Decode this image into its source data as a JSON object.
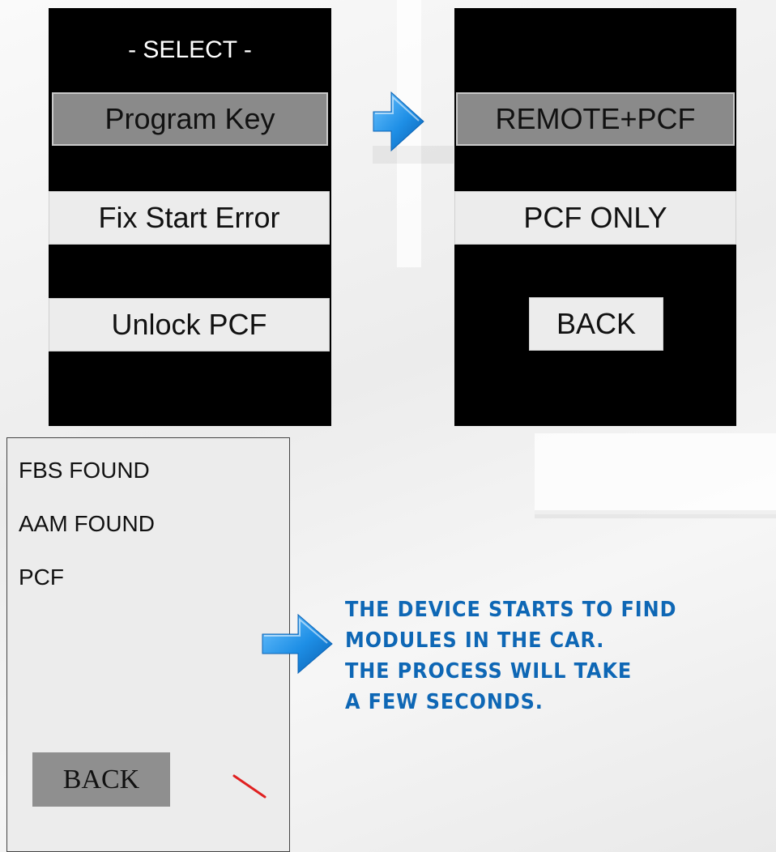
{
  "left_screen": {
    "title": "- SELECT -",
    "items": [
      {
        "label": "Program Key",
        "state": "selected"
      },
      {
        "label": "Fix Start Error",
        "state": "normal"
      },
      {
        "label": "Unlock PCF",
        "state": "normal"
      }
    ]
  },
  "right_screen": {
    "items": [
      {
        "label": "REMOTE+PCF",
        "state": "selected"
      },
      {
        "label": "PCF ONLY",
        "state": "normal"
      },
      {
        "label": "BACK",
        "state": "normal"
      }
    ]
  },
  "results_screen": {
    "lines": [
      "FBS FOUND",
      "AAM FOUND",
      "PCF"
    ],
    "back_label": "BACK"
  },
  "caption": {
    "lines": [
      "THE DEVICE STARTS TO FIND",
      "MODULES IN THE CAR.",
      "THE PROCESS WILL TAKE",
      "A FEW SECONDS."
    ]
  },
  "colors": {
    "screen": "#000000",
    "selected": "#8a8a8a",
    "button": "#ececec",
    "arrow": "#1e8fe6",
    "caption": "#0e67b5",
    "cursor": "#e02020"
  },
  "icons": [
    "arrow-right-icon",
    "arrow-right-icon",
    "loading-tick-icon"
  ]
}
